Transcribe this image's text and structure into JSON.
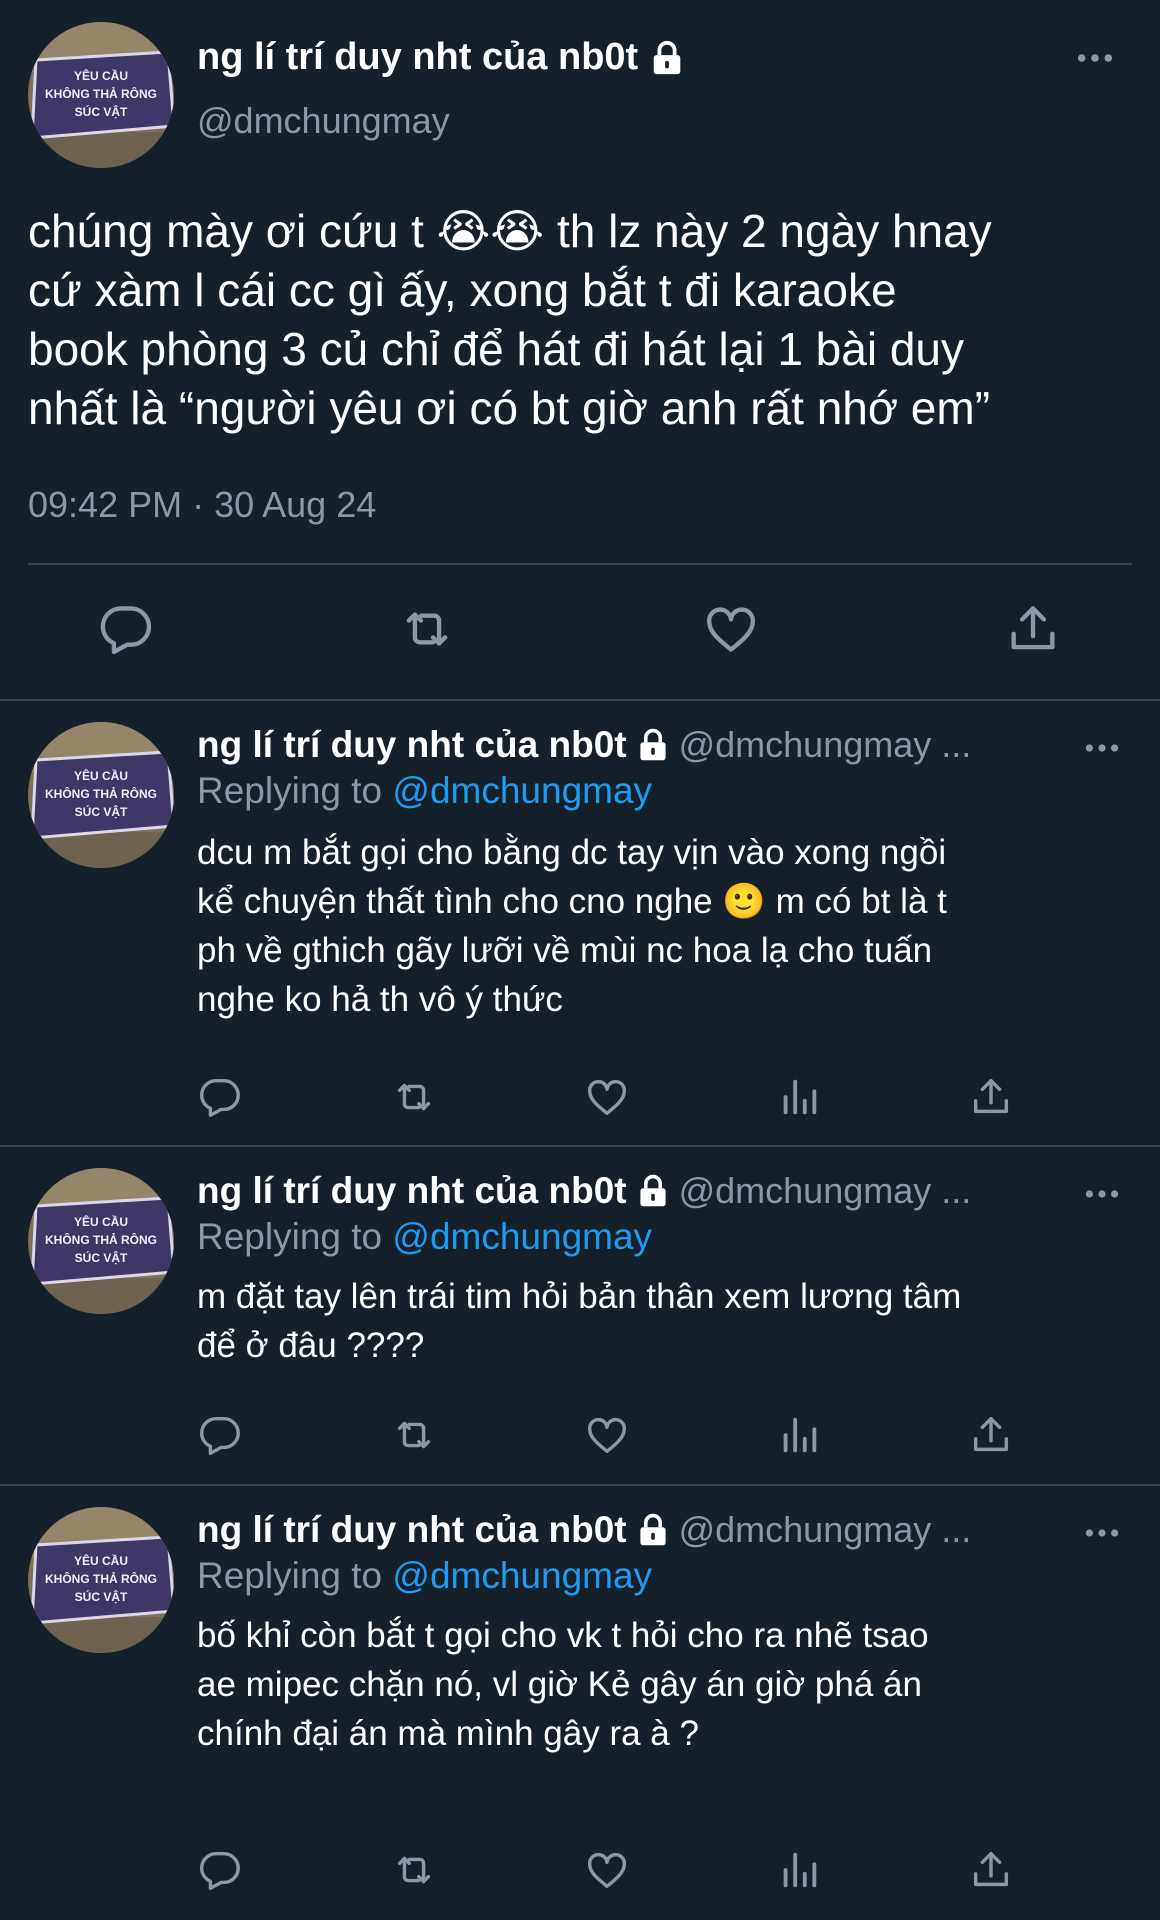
{
  "main_tweet": {
    "avatar_text": [
      "YÊU CẦU",
      "KHÔNG THẢ RÔNG",
      "SÚC VẬT"
    ],
    "author_name": "ng lí trí duy nht của nb0t",
    "handle": "@dmchungmay",
    "text_lines": [
      "chúng mày ơi cứu t 😭😭  th lz này 2 ngày hnay",
      "cứ xàm l cái cc gì ấy, xong bắt t đi karaoke",
      "book phòng 3 củ chỉ để hát đi hát lại 1 bài duy",
      "nhất là “người yêu ơi có bt giờ anh rất nhớ em”"
    ],
    "timestamp": "09:42 PM · 30 Aug 24",
    "actions": [
      "reply-icon",
      "retweet-icon",
      "like-icon",
      "share-icon"
    ]
  },
  "replies": [
    {
      "author_name": "ng lí trí duy nht của nb0t",
      "handle": "@dmchungmay ...",
      "replying_label": "Replying to",
      "replying_to": "@dmchungmay",
      "text_lines": [
        "dcu m bắt gọi cho bằng dc tay vịn vào xong ngồi",
        "kể chuyện thất tình cho cno nghe 🙂 m có bt là t",
        "ph về gthich gãy lưỡi về mùi nc hoa lạ cho tuấn",
        "nghe ko hả th vô ý thức"
      ]
    },
    {
      "author_name": "ng lí trí duy nht của nb0t",
      "handle": "@dmchungmay ...",
      "replying_label": "Replying to",
      "replying_to": "@dmchungmay",
      "text_lines": [
        "m đặt tay lên trái tim hỏi bản thân xem lương tâm",
        "để ở đâu ????"
      ]
    },
    {
      "author_name": "ng lí trí duy nht của nb0t",
      "handle": "@dmchungmay ...",
      "replying_label": "Replying to",
      "replying_to": "@dmchungmay",
      "text_lines": [
        "bố khỉ còn bắt t gọi cho vk t hỏi cho ra nhẽ tsao",
        "ae mipec chặn nó, vl giờ Kẻ gây án giờ phá án",
        "chính đại án mà mình gây ra à ?"
      ]
    }
  ],
  "colors": {
    "background": "#15202b",
    "text": "#ffffff",
    "muted": "#8b98a5",
    "link": "#1d9bf0",
    "divider": "#38444d"
  }
}
